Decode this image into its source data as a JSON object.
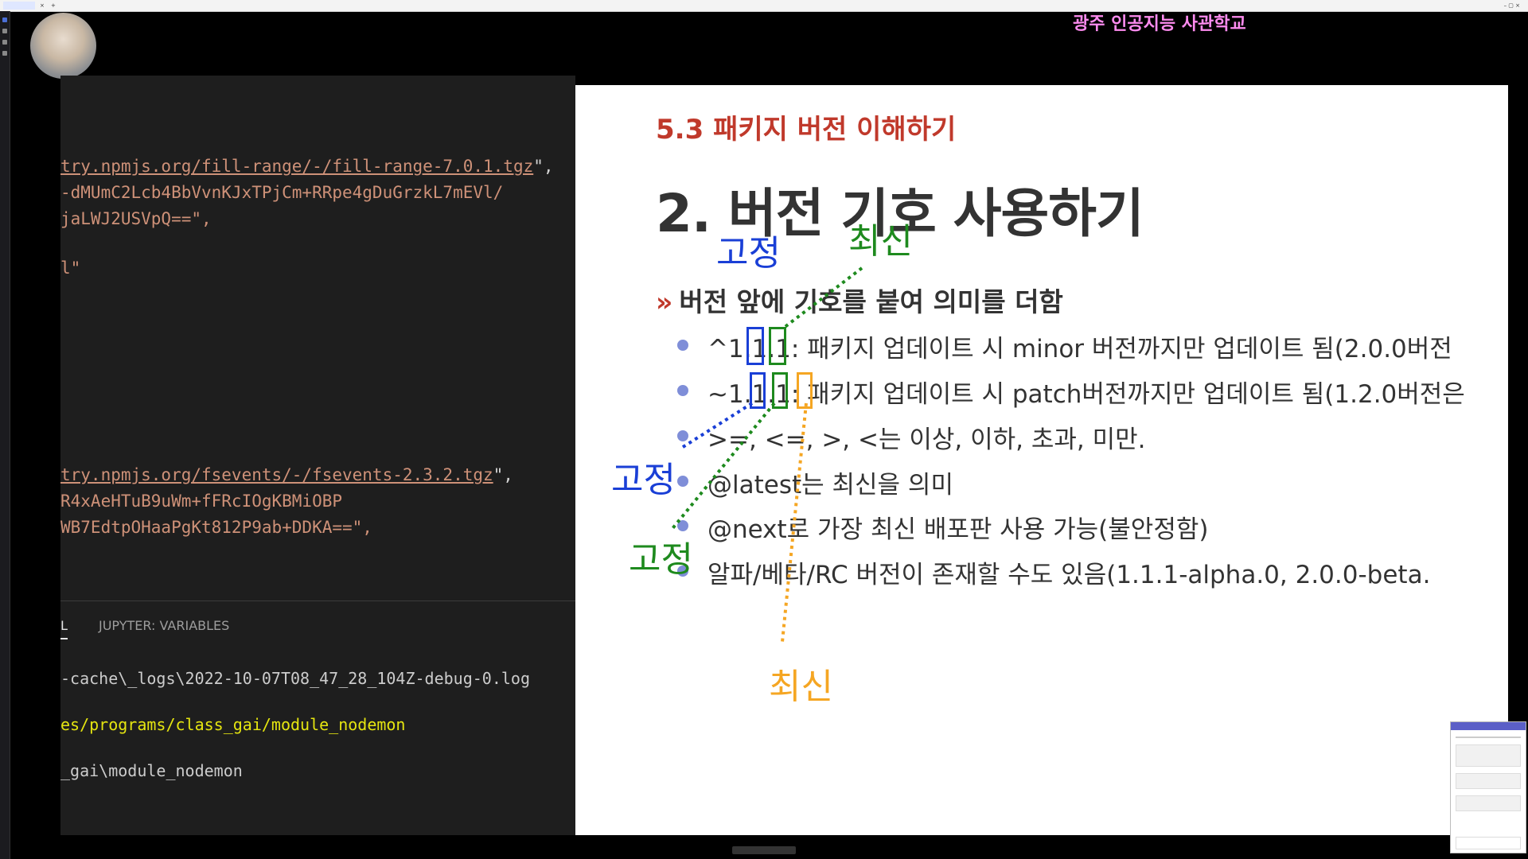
{
  "school_name": "광주 인공지능 사관학교",
  "editor": {
    "lines": [
      {
        "text": "try.npmjs.org/fill-range/-/fill-range-7.0.1.tgz",
        "suffix": "\","
      },
      {
        "text": "-dMUmC2Lcb4BbVvnKJxTPjCm+RRpe4gDuGrzkL7mEVl/",
        "suffix": ""
      },
      {
        "text": "jaLWJ2USVpQ==\",",
        "suffix": ""
      },
      {
        "text": "l\"",
        "suffix": ""
      },
      {
        "text": "try.npmjs.org/fsevents/-/fsevents-2.3.2.tgz",
        "suffix": "\","
      },
      {
        "text": "R4xAeHTuB9uWm+fFRcIOgKBMiOBP",
        "suffix": ""
      },
      {
        "text": "WB7EdtpOHaaPgKt812P9ab+DDKA==\",",
        "suffix": ""
      }
    ]
  },
  "terminal": {
    "tabs": [
      "L",
      "JUPYTER: VARIABLES"
    ],
    "lines": [
      "-cache\\_logs\\2022-10-07T08_47_28_104Z-debug-0.log",
      "es/programs/class_gai/module_nodemon",
      "_gai\\module_nodemon"
    ]
  },
  "slide": {
    "subtitle": "5.3 패키지 버전 이해하기",
    "title": "2. 버전 기호 사용하기",
    "lead_marker": "»",
    "lead": "버전 앞에 기호를 붙여 의미를 더함",
    "bullets": [
      "^1.1.1: 패키지 업데이트 시 minor 버전까지만 업데이트 됨(2.0.0버전",
      "~1.1.1: 패키지 업데이트 시 patch버전까지만 업데이트 됨(1.2.0버전은",
      ">=, <=, >, <는 이상, 이하, 초과, 미만.",
      "@latest는 최신을 의미",
      "@next로 가장 최신 배포판 사용 가능(불안정함)",
      "알파/베타/RC 버전이 존재할 수도 있음(1.1.1-alpha.0, 2.0.0-beta."
    ],
    "annotations": {
      "fixed_blue": "고정",
      "latest_green": "최신",
      "fixed_blue_2": "고정",
      "fixed_green": "고정",
      "latest_orange": "최신"
    }
  },
  "colors": {
    "annotation_blue": "#1a3fd6",
    "annotation_green": "#1e8a1e",
    "annotation_orange": "#f5a623",
    "subtitle_red": "#c0392b",
    "terminal_yellow": "#e5e510"
  }
}
